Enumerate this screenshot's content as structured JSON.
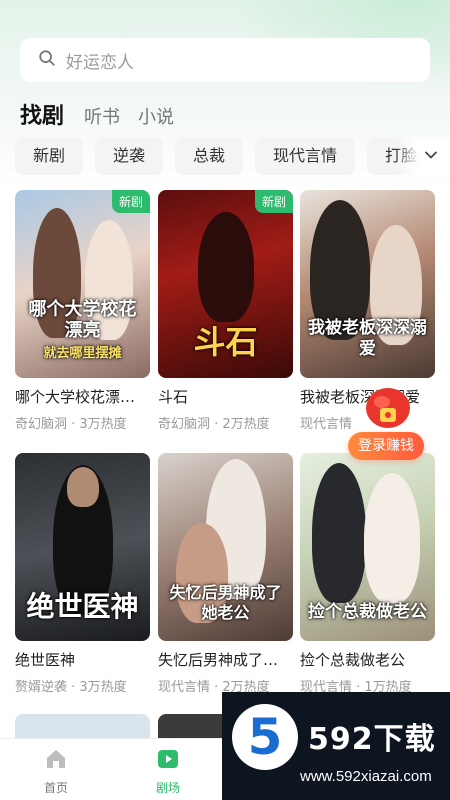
{
  "search": {
    "placeholder": "好运恋人"
  },
  "tabs": [
    {
      "label": "找剧",
      "active": true
    },
    {
      "label": "听书",
      "active": false
    },
    {
      "label": "小说",
      "active": false
    }
  ],
  "categories": [
    "新剧",
    "逆袭",
    "总裁",
    "现代言情",
    "打脸"
  ],
  "cards": [
    {
      "poster_title": "哪个大学校花漂亮",
      "poster_subtitle": "就去哪里摆摊",
      "badge": "新剧",
      "name": "哪个大学校花漂亮就去哪里摆摊",
      "meta": "奇幻脑洞 · 3万热度"
    },
    {
      "poster_title": "斗石",
      "badge": "新剧",
      "name": "斗石",
      "meta": "奇幻脑洞 · 2万热度"
    },
    {
      "poster_title": "我被老板深深溺爱",
      "badge": "",
      "name": "我被老板深深溺爱",
      "meta": "现代言情"
    },
    {
      "poster_title": "绝世医神",
      "badge": "",
      "name": "绝世医神",
      "meta": "赘婿逆袭 · 3万热度"
    },
    {
      "poster_title": "失忆后男神成了她老公",
      "badge": "",
      "name": "失忆后男神成了她老公",
      "meta": "现代言情 · 2万热度"
    },
    {
      "poster_title": "捡个总裁做老公",
      "badge": "",
      "name": "捡个总裁做老公",
      "meta": "现代言情 · 1万热度"
    }
  ],
  "promo": {
    "label": "登录赚钱"
  },
  "nav": [
    {
      "label": "首页",
      "icon": "home-icon",
      "active": false
    },
    {
      "label": "剧场",
      "icon": "theater-icon",
      "active": true
    }
  ],
  "watermark": {
    "logo_digit": "5",
    "title": "592下载",
    "url": "www.592xiazai.com"
  },
  "colors": {
    "accent": "#2dbb6d",
    "promo": "#ff6a3d"
  }
}
